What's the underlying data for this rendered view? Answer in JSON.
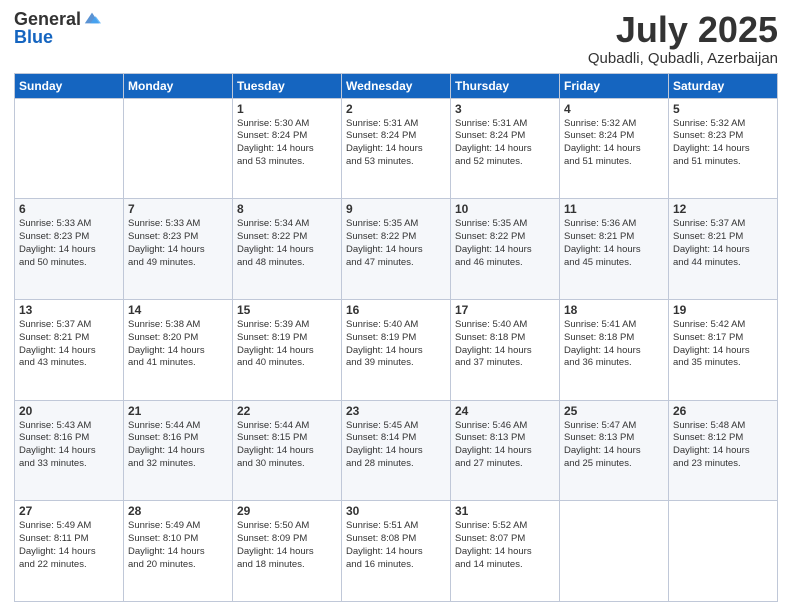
{
  "header": {
    "logo_general": "General",
    "logo_blue": "Blue",
    "month": "July 2025",
    "location": "Qubadli, Qubadli, Azerbaijan"
  },
  "days_of_week": [
    "Sunday",
    "Monday",
    "Tuesday",
    "Wednesday",
    "Thursday",
    "Friday",
    "Saturday"
  ],
  "weeks": [
    [
      {
        "day": "",
        "info": ""
      },
      {
        "day": "",
        "info": ""
      },
      {
        "day": "1",
        "info": "Sunrise: 5:30 AM\nSunset: 8:24 PM\nDaylight: 14 hours\nand 53 minutes."
      },
      {
        "day": "2",
        "info": "Sunrise: 5:31 AM\nSunset: 8:24 PM\nDaylight: 14 hours\nand 53 minutes."
      },
      {
        "day": "3",
        "info": "Sunrise: 5:31 AM\nSunset: 8:24 PM\nDaylight: 14 hours\nand 52 minutes."
      },
      {
        "day": "4",
        "info": "Sunrise: 5:32 AM\nSunset: 8:24 PM\nDaylight: 14 hours\nand 51 minutes."
      },
      {
        "day": "5",
        "info": "Sunrise: 5:32 AM\nSunset: 8:23 PM\nDaylight: 14 hours\nand 51 minutes."
      }
    ],
    [
      {
        "day": "6",
        "info": "Sunrise: 5:33 AM\nSunset: 8:23 PM\nDaylight: 14 hours\nand 50 minutes."
      },
      {
        "day": "7",
        "info": "Sunrise: 5:33 AM\nSunset: 8:23 PM\nDaylight: 14 hours\nand 49 minutes."
      },
      {
        "day": "8",
        "info": "Sunrise: 5:34 AM\nSunset: 8:22 PM\nDaylight: 14 hours\nand 48 minutes."
      },
      {
        "day": "9",
        "info": "Sunrise: 5:35 AM\nSunset: 8:22 PM\nDaylight: 14 hours\nand 47 minutes."
      },
      {
        "day": "10",
        "info": "Sunrise: 5:35 AM\nSunset: 8:22 PM\nDaylight: 14 hours\nand 46 minutes."
      },
      {
        "day": "11",
        "info": "Sunrise: 5:36 AM\nSunset: 8:21 PM\nDaylight: 14 hours\nand 45 minutes."
      },
      {
        "day": "12",
        "info": "Sunrise: 5:37 AM\nSunset: 8:21 PM\nDaylight: 14 hours\nand 44 minutes."
      }
    ],
    [
      {
        "day": "13",
        "info": "Sunrise: 5:37 AM\nSunset: 8:21 PM\nDaylight: 14 hours\nand 43 minutes."
      },
      {
        "day": "14",
        "info": "Sunrise: 5:38 AM\nSunset: 8:20 PM\nDaylight: 14 hours\nand 41 minutes."
      },
      {
        "day": "15",
        "info": "Sunrise: 5:39 AM\nSunset: 8:19 PM\nDaylight: 14 hours\nand 40 minutes."
      },
      {
        "day": "16",
        "info": "Sunrise: 5:40 AM\nSunset: 8:19 PM\nDaylight: 14 hours\nand 39 minutes."
      },
      {
        "day": "17",
        "info": "Sunrise: 5:40 AM\nSunset: 8:18 PM\nDaylight: 14 hours\nand 37 minutes."
      },
      {
        "day": "18",
        "info": "Sunrise: 5:41 AM\nSunset: 8:18 PM\nDaylight: 14 hours\nand 36 minutes."
      },
      {
        "day": "19",
        "info": "Sunrise: 5:42 AM\nSunset: 8:17 PM\nDaylight: 14 hours\nand 35 minutes."
      }
    ],
    [
      {
        "day": "20",
        "info": "Sunrise: 5:43 AM\nSunset: 8:16 PM\nDaylight: 14 hours\nand 33 minutes."
      },
      {
        "day": "21",
        "info": "Sunrise: 5:44 AM\nSunset: 8:16 PM\nDaylight: 14 hours\nand 32 minutes."
      },
      {
        "day": "22",
        "info": "Sunrise: 5:44 AM\nSunset: 8:15 PM\nDaylight: 14 hours\nand 30 minutes."
      },
      {
        "day": "23",
        "info": "Sunrise: 5:45 AM\nSunset: 8:14 PM\nDaylight: 14 hours\nand 28 minutes."
      },
      {
        "day": "24",
        "info": "Sunrise: 5:46 AM\nSunset: 8:13 PM\nDaylight: 14 hours\nand 27 minutes."
      },
      {
        "day": "25",
        "info": "Sunrise: 5:47 AM\nSunset: 8:13 PM\nDaylight: 14 hours\nand 25 minutes."
      },
      {
        "day": "26",
        "info": "Sunrise: 5:48 AM\nSunset: 8:12 PM\nDaylight: 14 hours\nand 23 minutes."
      }
    ],
    [
      {
        "day": "27",
        "info": "Sunrise: 5:49 AM\nSunset: 8:11 PM\nDaylight: 14 hours\nand 22 minutes."
      },
      {
        "day": "28",
        "info": "Sunrise: 5:49 AM\nSunset: 8:10 PM\nDaylight: 14 hours\nand 20 minutes."
      },
      {
        "day": "29",
        "info": "Sunrise: 5:50 AM\nSunset: 8:09 PM\nDaylight: 14 hours\nand 18 minutes."
      },
      {
        "day": "30",
        "info": "Sunrise: 5:51 AM\nSunset: 8:08 PM\nDaylight: 14 hours\nand 16 minutes."
      },
      {
        "day": "31",
        "info": "Sunrise: 5:52 AM\nSunset: 8:07 PM\nDaylight: 14 hours\nand 14 minutes."
      },
      {
        "day": "",
        "info": ""
      },
      {
        "day": "",
        "info": ""
      }
    ]
  ]
}
